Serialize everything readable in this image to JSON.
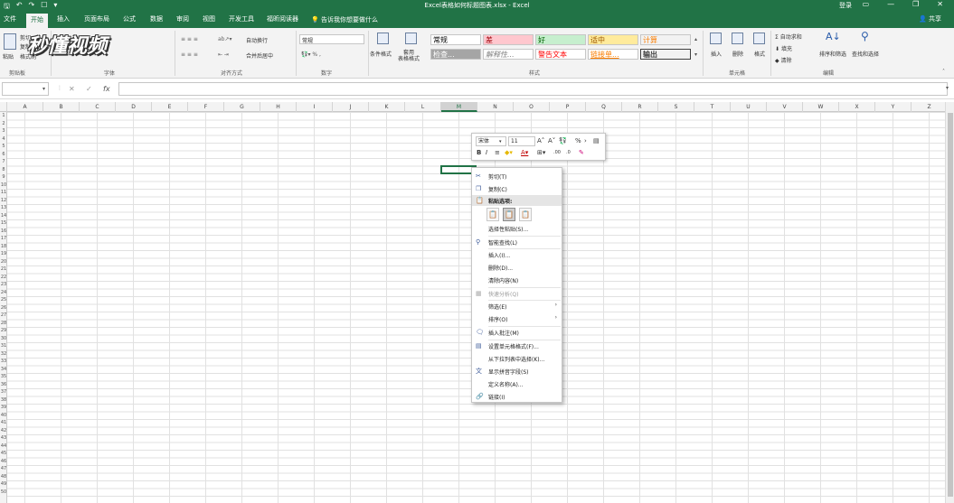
{
  "title_bar": {
    "title": "Excel表格如何标题图表.xlsx - Excel",
    "login": "登录",
    "qat_icons": [
      "save-icon",
      "undo-icon",
      "redo-icon",
      "touch-mode-icon",
      "customize-icon"
    ],
    "window_buttons": [
      "ribbon-display-icon",
      "minimize-icon",
      "restore-icon",
      "close-icon"
    ]
  },
  "tabs": {
    "file": "文件",
    "home": "开始",
    "insert": "插入",
    "page_layout": "页面布局",
    "formulas": "公式",
    "data": "数据",
    "review": "审阅",
    "view": "视图",
    "developer": "开发工具",
    "foxit": "福昕阅读器",
    "tell_me": "告诉我你想要做什么",
    "share": "共享"
  },
  "ribbon": {
    "clipboard": {
      "label": "剪贴板",
      "paste": "粘贴",
      "cut": "剪切",
      "copy": "复制",
      "painter": "格式刷"
    },
    "font": {
      "label": "字体"
    },
    "alignment": {
      "label": "对齐方式",
      "wrap": "自动换行",
      "merge": "合并后居中"
    },
    "number": {
      "label": "数字",
      "format": "常规"
    },
    "styles": {
      "label": "样式",
      "conditional": "条件格式",
      "table": "套用\n表格格式",
      "cells": [
        {
          "text": "常规",
          "bg": "#ffffff",
          "color": "#000000"
        },
        {
          "text": "差",
          "bg": "#ffc7ce",
          "color": "#9c0006"
        },
        {
          "text": "好",
          "bg": "#c6efce",
          "color": "#006100"
        },
        {
          "text": "适中",
          "bg": "#ffeb9c",
          "color": "#9c5700"
        },
        {
          "text": "计算",
          "bg": "#f2f2f2",
          "color": "#fa7d00"
        },
        {
          "text": "检查...",
          "bg": "#a5a5a5",
          "color": "#ffffff"
        },
        {
          "text": "解释性...",
          "bg": "#ffffff",
          "color": "#7f7f7f"
        },
        {
          "text": "警告文本",
          "bg": "#ffffff",
          "color": "#ff0000"
        },
        {
          "text": "链接单...",
          "bg": "#ffffff",
          "color": "#fa7d00"
        },
        {
          "text": "输出",
          "bg": "#f2f2f2",
          "color": "#3f3f3f"
        }
      ]
    },
    "cells": {
      "label": "单元格",
      "insert": "插入",
      "delete": "删除",
      "format": "格式"
    },
    "editing": {
      "label": "编辑",
      "autosum": "自动求和",
      "fill": "填充",
      "clear": "清除",
      "sort": "排序和筛选",
      "find": "查找和选择"
    }
  },
  "watermark": "秒懂视频",
  "formula_bar": {
    "name_box": "",
    "formula": "",
    "fx": "fx"
  },
  "grid": {
    "columns": [
      "A",
      "B",
      "C",
      "D",
      "E",
      "F",
      "G",
      "H",
      "I",
      "J",
      "K",
      "L",
      "M",
      "N",
      "O",
      "P",
      "Q",
      "R",
      "S",
      "T",
      "U",
      "V",
      "W",
      "X",
      "Y",
      "Z"
    ],
    "selected_column": "M",
    "rows": [
      "1",
      "2",
      "3",
      "4",
      "5",
      "6",
      "7",
      "8",
      "9",
      "10",
      "11",
      "12",
      "13",
      "14",
      "15",
      "16",
      "17",
      "18",
      "19",
      "20",
      "21",
      "22",
      "23",
      "24",
      "25",
      "26",
      "27",
      "28",
      "29",
      "30",
      "31",
      "32",
      "33",
      "34",
      "35",
      "36",
      "37",
      "38",
      "39",
      "40",
      "41",
      "42",
      "43",
      "44",
      "45",
      "46",
      "47",
      "48",
      "49",
      "50"
    ]
  },
  "mini_toolbar": {
    "font": "宋体",
    "size": "11",
    "percent": "%"
  },
  "context_menu": {
    "items": [
      {
        "label": "剪切(T)",
        "icon": "cut-icon",
        "disabled": false
      },
      {
        "label": "复制(C)",
        "icon": "copy-icon",
        "disabled": false
      },
      {
        "label": "粘贴选项:",
        "icon": "paste-icon",
        "disabled": false
      },
      {
        "label": "选择性粘贴(S)...",
        "icon": "",
        "disabled": false
      },
      {
        "label": "智能查找(L)",
        "icon": "smart-lookup-icon",
        "disabled": false
      },
      {
        "label": "插入(I)...",
        "icon": "",
        "disabled": false
      },
      {
        "label": "删除(D)...",
        "icon": "",
        "disabled": false
      },
      {
        "label": "清除内容(N)",
        "icon": "",
        "disabled": false
      },
      {
        "label": "快速分析(Q)",
        "icon": "quick-analysis-icon",
        "disabled": true
      },
      {
        "label": "筛选(E)",
        "icon": "",
        "disabled": false
      },
      {
        "label": "排序(O)",
        "icon": "",
        "disabled": false
      },
      {
        "label": "插入批注(M)",
        "icon": "comment-icon",
        "disabled": false
      },
      {
        "label": "设置单元格格式(F)...",
        "icon": "format-cells-icon",
        "disabled": false
      },
      {
        "label": "从下拉列表中选择(K)...",
        "icon": "",
        "disabled": false
      },
      {
        "label": "显示拼音字段(S)",
        "icon": "phonetic-icon",
        "disabled": false
      },
      {
        "label": "定义名称(A)...",
        "icon": "",
        "disabled": false
      },
      {
        "label": "链接(I)",
        "icon": "link-icon",
        "disabled": false
      }
    ]
  }
}
